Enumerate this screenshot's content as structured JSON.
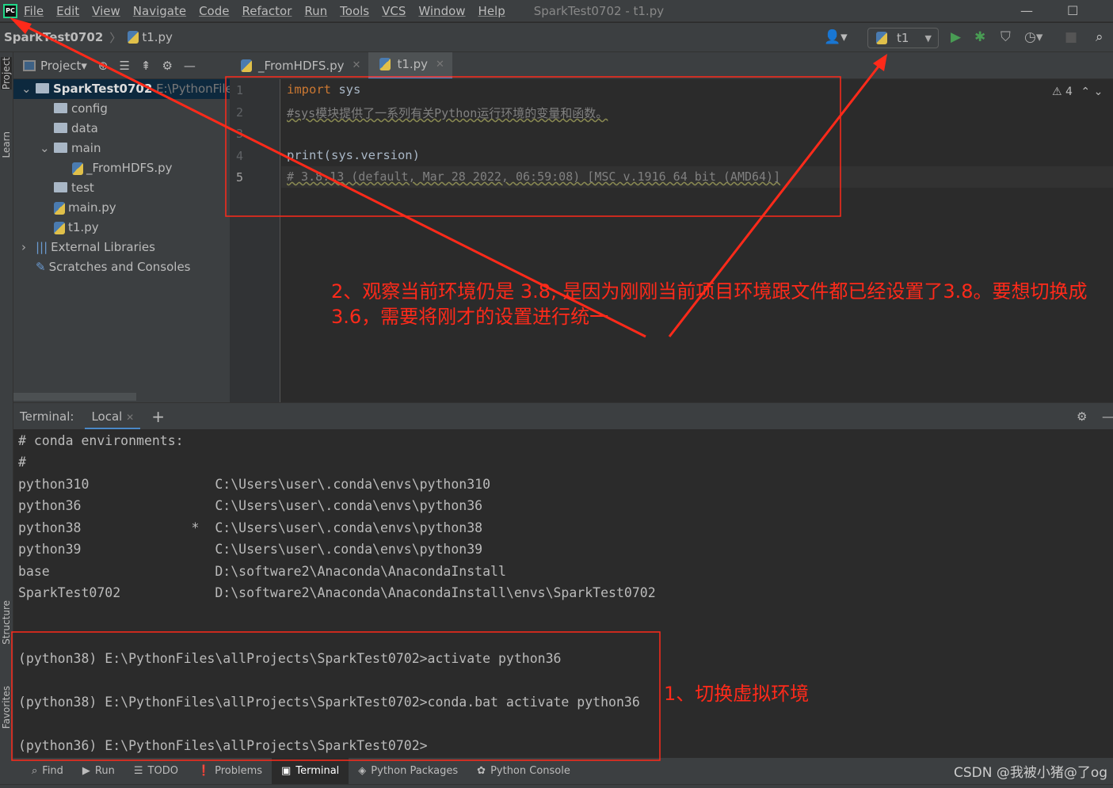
{
  "menubar": {
    "items": [
      "File",
      "Edit",
      "View",
      "Navigate",
      "Code",
      "Refactor",
      "Run",
      "Tools",
      "VCS",
      "Window",
      "Help"
    ],
    "title": "SparkTest0702 - t1.py"
  },
  "navbar": {
    "project": "SparkTest0702",
    "file": "t1.py",
    "run_config": "t1"
  },
  "side_labels": {
    "project": "Project",
    "learn": "Learn",
    "structure": "Structure",
    "favorites": "Favorites"
  },
  "project_panel": {
    "title": "Project",
    "tree": [
      {
        "label": "SparkTest0702",
        "hint": "E:\\PythonFiles",
        "type": "folder",
        "depth": 0,
        "expanded": true,
        "selected": true
      },
      {
        "label": "config",
        "type": "folder",
        "depth": 1
      },
      {
        "label": "data",
        "type": "folder",
        "depth": 1
      },
      {
        "label": "main",
        "type": "folder",
        "depth": 1,
        "expanded": true
      },
      {
        "label": "_FromHDFS.py",
        "type": "py",
        "depth": 2
      },
      {
        "label": "test",
        "type": "folder",
        "depth": 1
      },
      {
        "label": "main.py",
        "type": "py",
        "depth": 1
      },
      {
        "label": "t1.py",
        "type": "py",
        "depth": 1
      },
      {
        "label": "External Libraries",
        "type": "lib",
        "depth": 0,
        "expanded": false
      },
      {
        "label": "Scratches and Consoles",
        "type": "scratch",
        "depth": 0
      }
    ]
  },
  "editor": {
    "tabs": [
      {
        "label": "_FromHDFS.py",
        "active": false
      },
      {
        "label": "t1.py",
        "active": true
      }
    ],
    "warnings": "4",
    "lines": [
      {
        "n": "1",
        "kw": "import",
        "rest": " sys"
      },
      {
        "n": "2",
        "comment": "#sys模块提供了一系列有关Python运行环境的变量和函数。"
      },
      {
        "n": "3"
      },
      {
        "n": "4",
        "rest": "print(sys.version)"
      },
      {
        "n": "5",
        "comment": "# 3.8.13 (default, Mar 28 2022, 06:59:08) [MSC v.1916 64 bit (AMD64)]"
      }
    ]
  },
  "terminal": {
    "label": "Terminal:",
    "tab": "Local",
    "lines": [
      "# conda environments:",
      "#",
      "python310                C:\\Users\\user\\.conda\\envs\\python310",
      "python36                 C:\\Users\\user\\.conda\\envs\\python36",
      "python38              *  C:\\Users\\user\\.conda\\envs\\python38",
      "python39                 C:\\Users\\user\\.conda\\envs\\python39",
      "base                     D:\\software2\\Anaconda\\AnacondaInstall",
      "SparkTest0702            D:\\software2\\Anaconda\\AnacondaInstall\\envs\\SparkTest0702",
      "(python38) E:\\PythonFiles\\allProjects\\SparkTest0702>activate python36",
      "(python38) E:\\PythonFiles\\allProjects\\SparkTest0702>conda.bat activate python36",
      "(python36) E:\\PythonFiles\\allProjects\\SparkTest0702>"
    ]
  },
  "bottombar": [
    "Find",
    "Run",
    "TODO",
    "Problems",
    "Terminal",
    "Python Packages",
    "Python Console"
  ],
  "annotations": {
    "a1": "1、切换虚拟环境",
    "a2": "2、观察当前环境仍是 3.8, 是因为刚刚当前项目环境跟文件都已经设置了3.8。要想切换成3.6，需要将刚才的设置进行统一",
    "watermark": "CSDN @我被小猪@了og",
    "color": "#ff2a1a"
  }
}
